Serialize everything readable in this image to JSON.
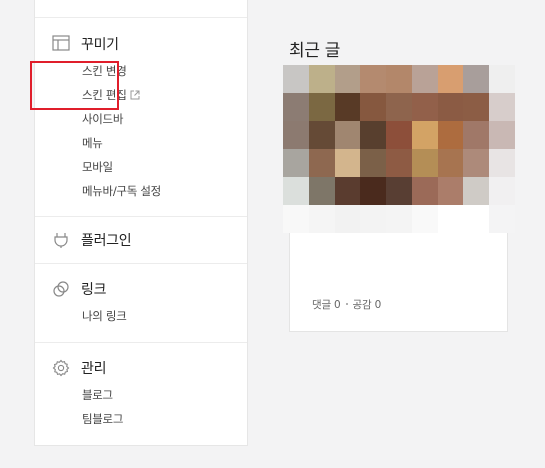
{
  "sidebar": {
    "sections": [
      {
        "title": "꾸미기",
        "icon": "layout-icon",
        "items": [
          {
            "label": "스킨 변경"
          },
          {
            "label": "스킨 편집",
            "icon": "external-link-icon"
          },
          {
            "label": "사이드바"
          },
          {
            "label": "메뉴"
          },
          {
            "label": "모바일"
          },
          {
            "label": "메뉴바/구독 설정"
          }
        ]
      },
      {
        "title": "플러그인",
        "icon": "plug-icon",
        "items": []
      },
      {
        "title": "링크",
        "icon": "link-icon",
        "items": [
          {
            "label": "나의 링크"
          }
        ]
      },
      {
        "title": "관리",
        "icon": "gear-icon",
        "items": [
          {
            "label": "블로그"
          },
          {
            "label": "팀블로그"
          }
        ]
      }
    ]
  },
  "recent": {
    "title": "최근 글",
    "post": {
      "comments_label": "댓글 0",
      "likes_label": "공감 0"
    }
  },
  "colors": {
    "highlight_border": "#e01e2b",
    "thumb_pixels": [
      "#c8c6c4",
      "#bdb08a",
      "#b29e8a",
      "#b48a6f",
      "#b3876a",
      "#b9a297",
      "#d89e70",
      "#a89e9b",
      "#efefef",
      "#8c7c73",
      "#7b6842",
      "#583a26",
      "#86583f",
      "#8e644d",
      "#92604a",
      "#8b5b44",
      "#8c5d45",
      "#d7cdcb",
      "#8c7a70",
      "#654a36",
      "#a08670",
      "#583f2e",
      "#8d4f3a",
      "#d3a365",
      "#ad6c3f",
      "#a07868",
      "#c9b8b4",
      "#a8a59f",
      "#8e6850",
      "#d3b58d",
      "#7b6048",
      "#8e5b44",
      "#b48e56",
      "#a77450",
      "#ad8a7a",
      "#e8e4e4",
      "#dbdfdc",
      "#7e7668",
      "#5a3c2f",
      "#4a2a1d",
      "#583e33",
      "#9b6a58",
      "#ab7d6a",
      "#cfcbc6",
      "#f1f0f1",
      "#f8f8f8",
      "#f5f5f5",
      "#f2f2f2",
      "#f3f3f3",
      "#f4f4f4",
      "#f9f9f9",
      "#ffffff",
      "#ffffff",
      "#f4f4f5"
    ]
  }
}
